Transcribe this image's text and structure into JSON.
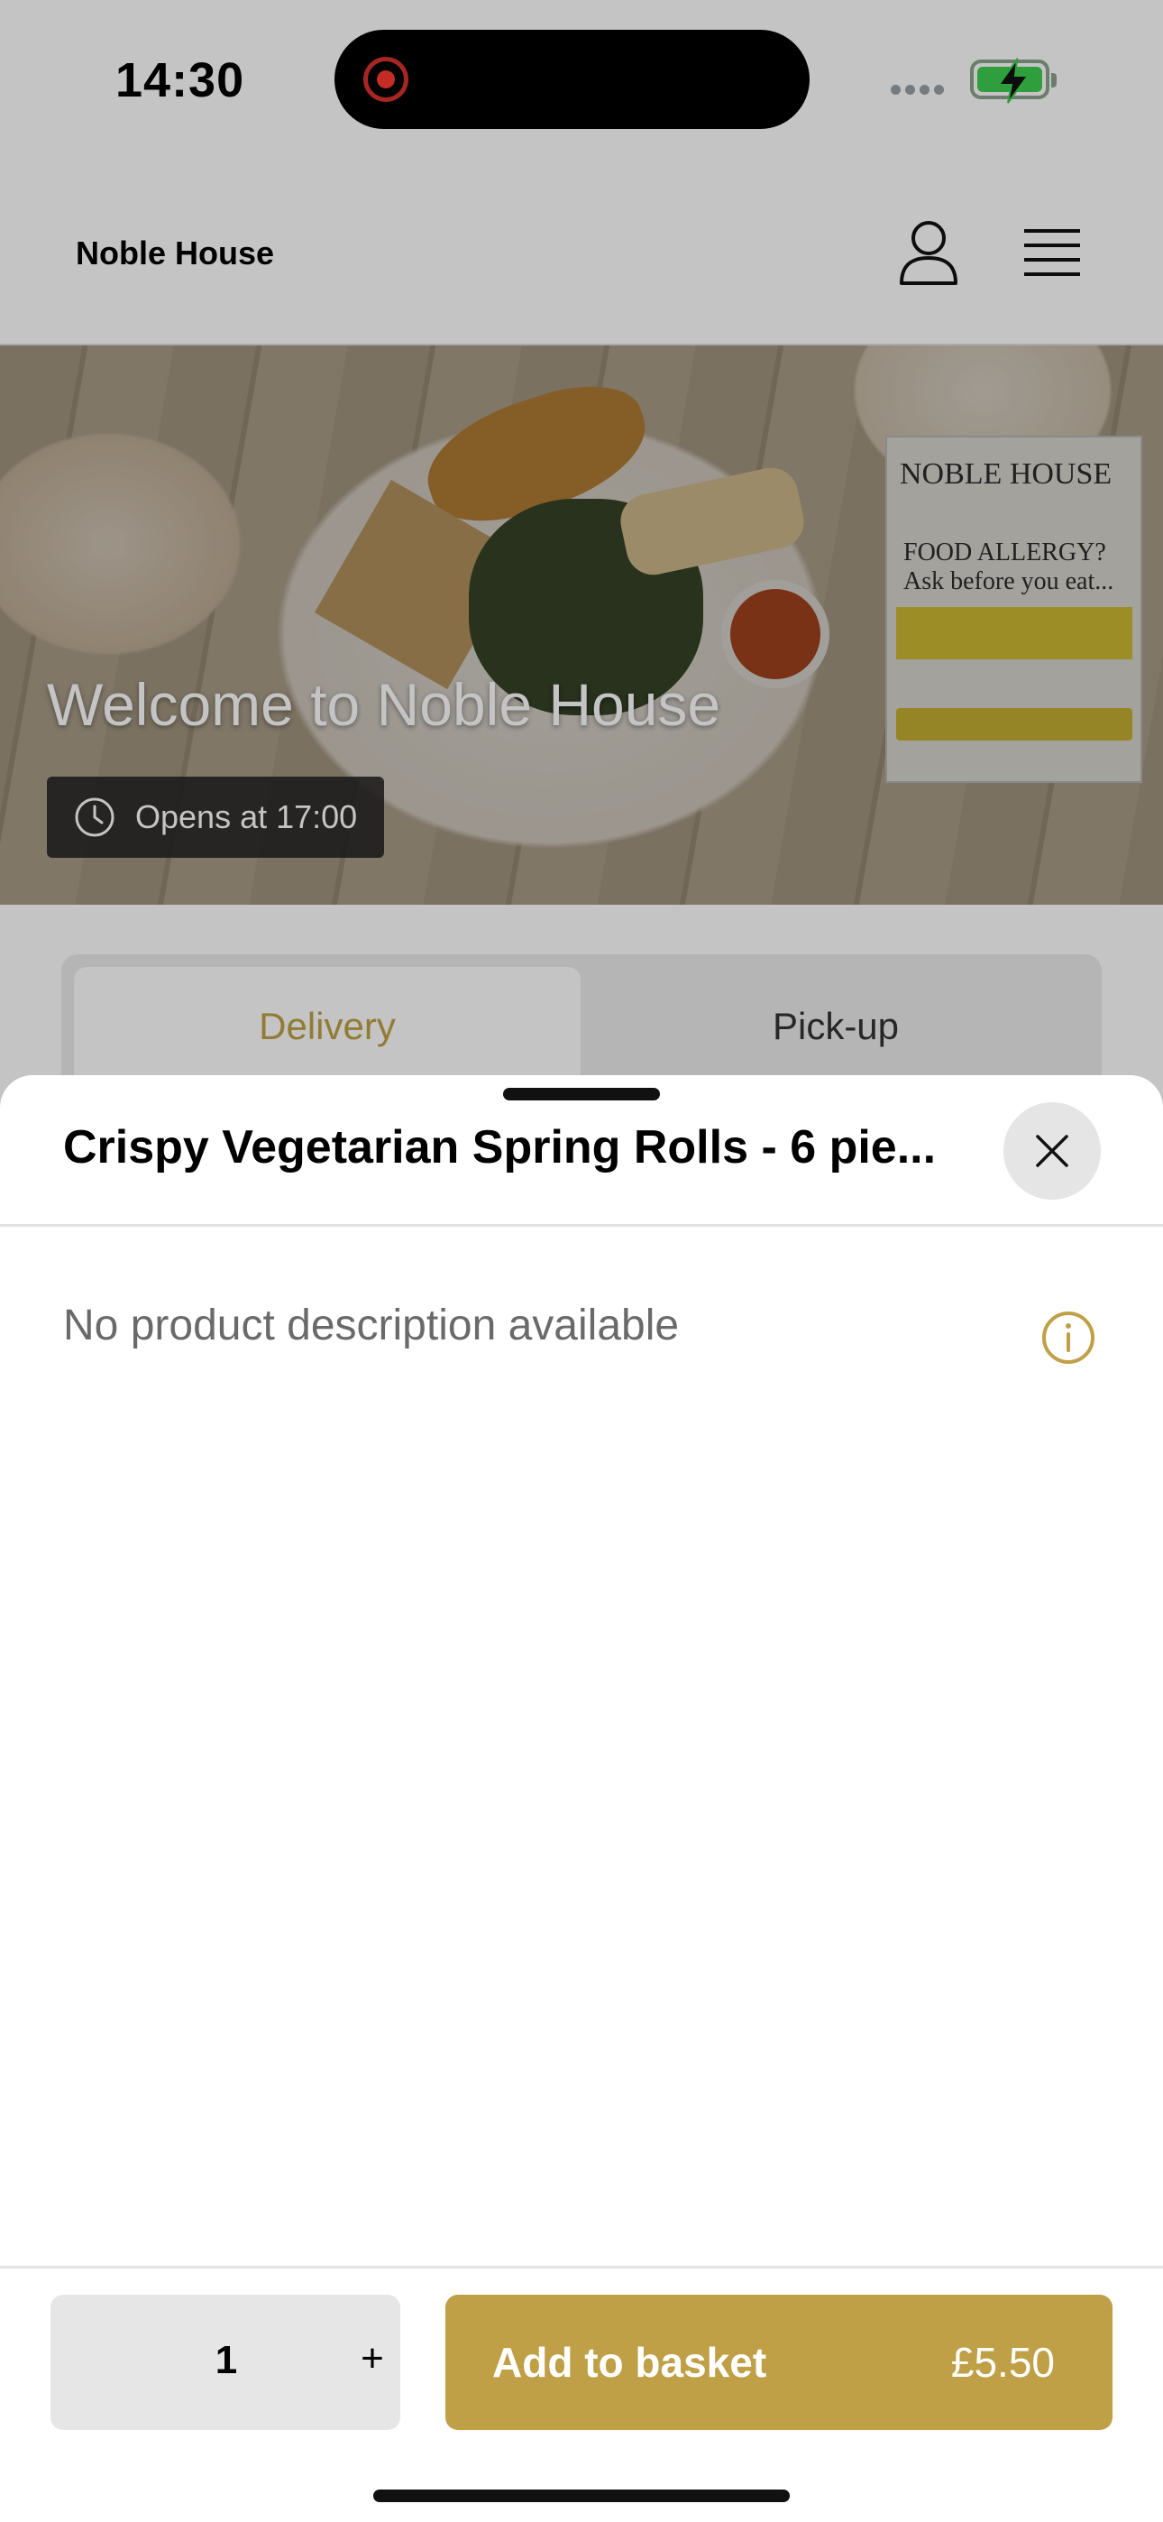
{
  "status_bar": {
    "time": "14:30"
  },
  "header": {
    "brand": "Noble House"
  },
  "hero": {
    "title": "Welcome to Noble House",
    "hours": "Opens at 17:00",
    "poster_brand": "NOBLE HOUSE",
    "poster_headline": "FOOD ALLERGY?",
    "poster_subline": "Ask before you eat..."
  },
  "tabs": [
    {
      "label": "Delivery",
      "selected": true
    },
    {
      "label": "Pick-up",
      "selected": false
    }
  ],
  "product_sheet": {
    "title": "Crispy Vegetarian Spring Rolls - 6 pie...",
    "description": "No product description available",
    "quantity": "1",
    "plus_label": "+",
    "add_label": "Add to basket",
    "price": "£5.50"
  },
  "colors": {
    "accent": "#bfa046",
    "overlay": "rgba(0,0,0,0.23)",
    "stepper_bg": "#e6e6e6"
  },
  "icons": [
    "user-icon",
    "menu-icon",
    "clock-icon",
    "close-icon",
    "info-icon",
    "battery-charging-icon",
    "record-icon"
  ]
}
